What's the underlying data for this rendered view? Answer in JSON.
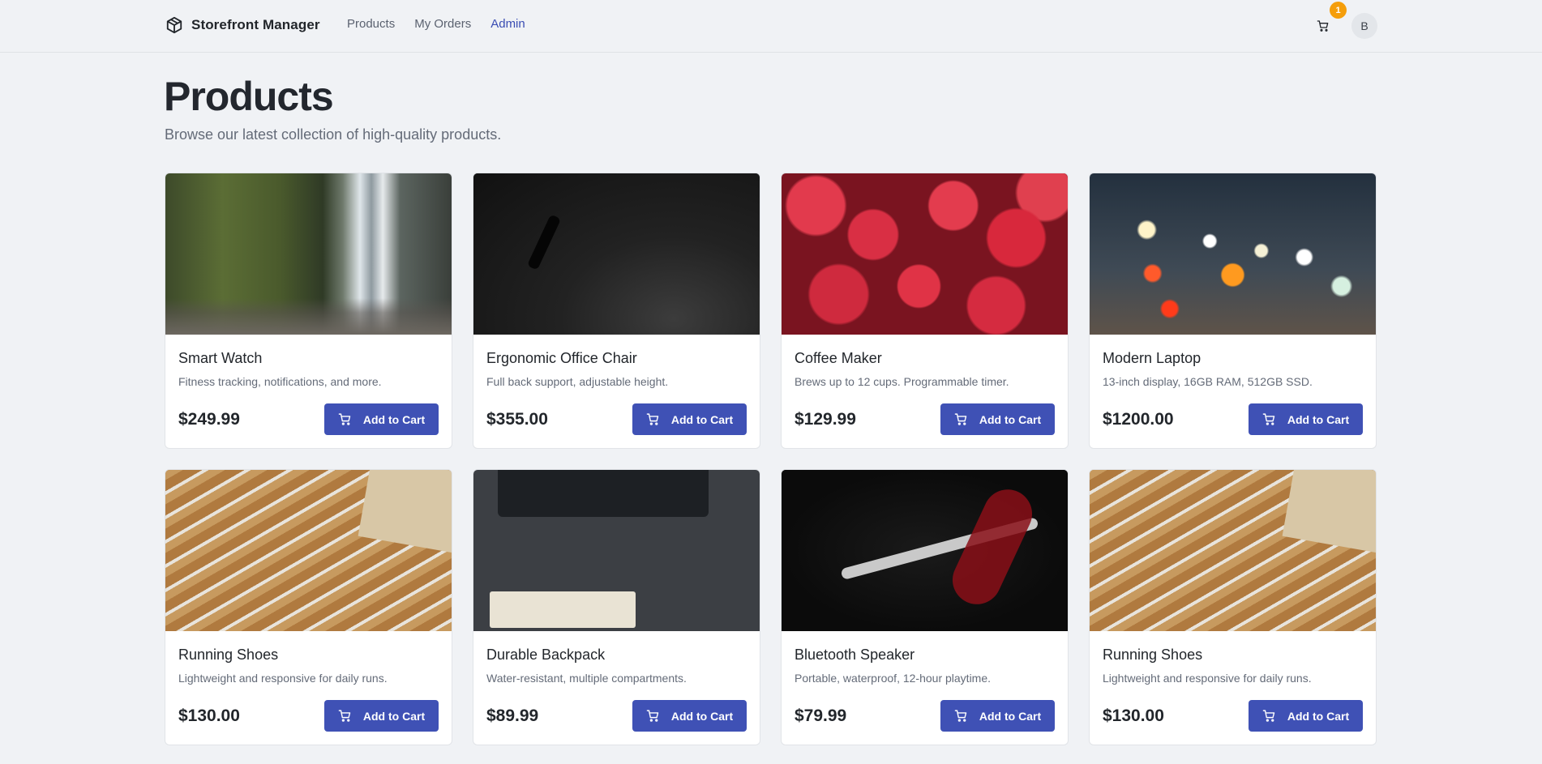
{
  "header": {
    "brand": "Storefront Manager",
    "nav": [
      {
        "label": "Products",
        "active": false
      },
      {
        "label": "My Orders",
        "active": false
      },
      {
        "label": "Admin",
        "active": true
      }
    ],
    "cart_count": "1",
    "avatar_initial": "B"
  },
  "page": {
    "title": "Products",
    "subtitle": "Browse our latest collection of high-quality products."
  },
  "products": [
    {
      "name": "Smart Watch",
      "description": "Fitness tracking, notifications, and more.",
      "price": "$249.99",
      "button": "Add to Cart",
      "image": "waterfall"
    },
    {
      "name": "Ergonomic Office Chair",
      "description": "Full back support, adjustable height.",
      "price": "$355.00",
      "button": "Add to Cart",
      "image": "diver"
    },
    {
      "name": "Coffee Maker",
      "description": "Brews up to 12 cups. Programmable timer.",
      "price": "$129.99",
      "button": "Add to Cart",
      "image": "strawberry"
    },
    {
      "name": "Modern Laptop",
      "description": "13-inch display, 16GB RAM, 512GB SSD.",
      "price": "$1200.00",
      "button": "Add to Cart",
      "image": "bokeh"
    },
    {
      "name": "Running Shoes",
      "description": "Lightweight and responsive for daily runs.",
      "price": "$130.00",
      "button": "Add to Cart",
      "image": "pencils"
    },
    {
      "name": "Durable Backpack",
      "description": "Water-resistant, multiple compartments.",
      "price": "$89.99",
      "button": "Add to Cart",
      "image": "desk"
    },
    {
      "name": "Bluetooth Speaker",
      "description": "Portable, waterproof, 12-hour playtime.",
      "price": "$79.99",
      "button": "Add to Cart",
      "image": "antler"
    },
    {
      "name": "Running Shoes",
      "description": "Lightweight and responsive for daily runs.",
      "price": "$130.00",
      "button": "Add to Cart",
      "image": "pencils"
    }
  ],
  "colors": {
    "accent": "#3f51b5",
    "badge": "#f59e0b",
    "background": "#f0f2f5"
  }
}
